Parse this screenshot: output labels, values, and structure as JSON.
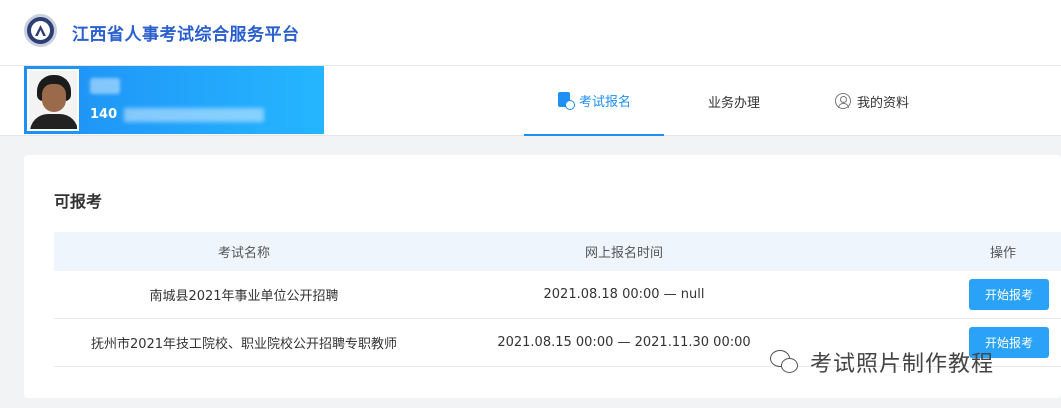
{
  "header": {
    "site_title": "江西省人事考试综合服务平台"
  },
  "profile": {
    "name": "",
    "id_prefix": "140"
  },
  "nav": {
    "tabs": [
      {
        "label": "考试报名",
        "icon": "document-icon",
        "active": true
      },
      {
        "label": "业务办理",
        "active": false
      },
      {
        "label": "我的资料",
        "icon": "user-icon",
        "active": false
      }
    ]
  },
  "main": {
    "section_title": "可报考",
    "table": {
      "headers": [
        "考试名称",
        "网上报名时间",
        "操作"
      ],
      "rows": [
        {
          "name": "南城县2021年事业单位公开招聘",
          "time": "2021.08.18 00:00 — null",
          "action": "开始报考"
        },
        {
          "name": "抚州市2021年技工院校、职业院校公开招聘专职教师",
          "time": "2021.08.15 00:00 — 2021.11.30 00:00",
          "action": "开始报考"
        }
      ]
    }
  },
  "watermark": {
    "text": "考试照片制作教程",
    "icon": "wechat-icon"
  },
  "colors": {
    "brand": "#2a5fcf",
    "accent": "#1e8ff5",
    "button": "#29a2f8",
    "table_header_bg": "#eef5fd"
  }
}
